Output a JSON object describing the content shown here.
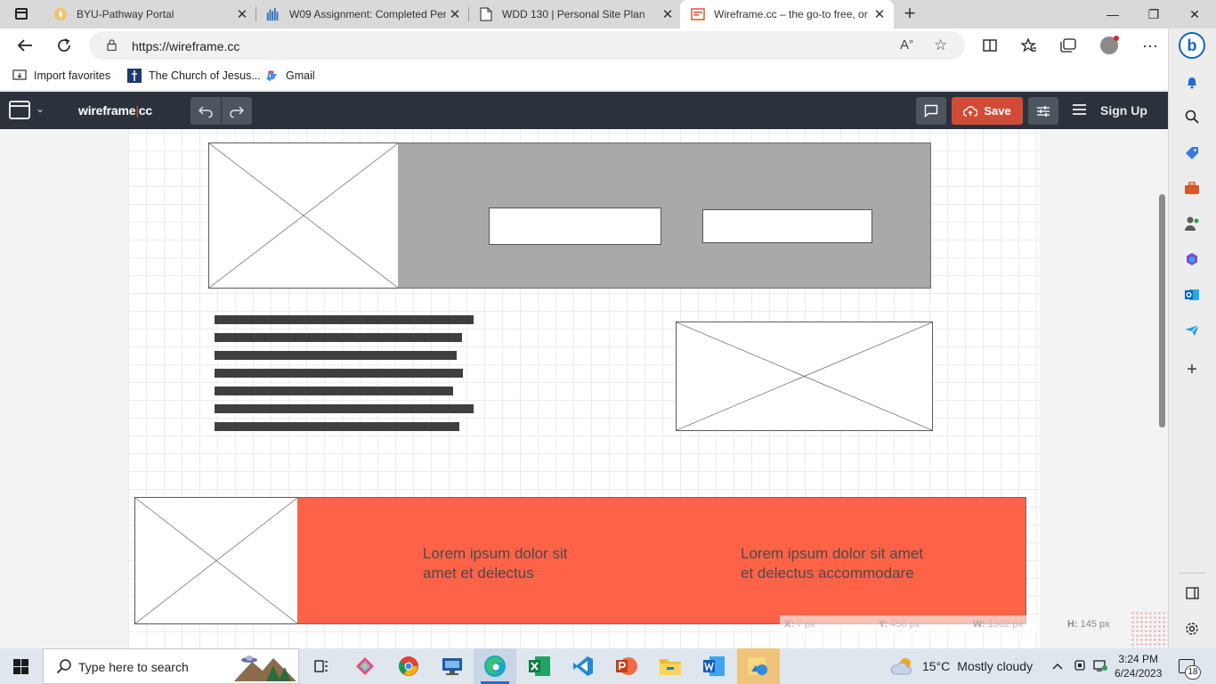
{
  "browser": {
    "tabs": [
      {
        "title": "BYU-Pathway Portal",
        "icon": "pathway-favicon",
        "active": false
      },
      {
        "title": "W09 Assignment: Completed Per",
        "icon": "canvas-favicon",
        "active": false
      },
      {
        "title": "WDD 130 | Personal Site Plan",
        "icon": "document-favicon",
        "active": false
      },
      {
        "title": "Wireframe.cc – the go-to free, or",
        "icon": "wireframe-favicon",
        "active": true
      }
    ],
    "close_glyph": "✕",
    "new_tab_glyph": "+",
    "window_controls": {
      "minimize": "—",
      "maximize": "❐",
      "close": "✕"
    },
    "url": "https://wireframe.cc",
    "favorites": [
      {
        "label": "Import favorites",
        "icon": "import-icon"
      },
      {
        "label": "The Church of Jesus...",
        "icon": "church-icon"
      },
      {
        "label": "Gmail",
        "icon": "google-icon"
      }
    ]
  },
  "app": {
    "logo_left": "wireframe",
    "logo_sep": "|",
    "logo_right": "cc",
    "undo_glyph": "↶",
    "redo_glyph": "↷",
    "save_label": "Save",
    "signup_label": "Sign Up"
  },
  "canvas": {
    "footer_text_1_line_1": "Lorem ipsum dolor sit",
    "footer_text_1_line_2": "amet et delectus",
    "footer_text_2_line_1": "Lorem ipsum dolor sit amet",
    "footer_text_2_line_2": "et delectus accommodare",
    "header_color": "#a9a9a9",
    "footer_color": "#ff6347"
  },
  "statusbar": {
    "x_label": "X:",
    "x_value": "7 px",
    "y_label": "Y:",
    "y_value": "456 px",
    "w_label": "W:",
    "w_value": "1002 px",
    "h_label": "H:",
    "h_value": "145 px"
  },
  "taskbar": {
    "search_placeholder": "Type here to search",
    "apps": [
      "task-view",
      "snipping-tool",
      "chrome",
      "remote-desktop",
      "edge",
      "excel",
      "vscode",
      "powerpoint",
      "file-explorer",
      "word",
      "photos"
    ],
    "weather_temp": "15°C",
    "weather_desc": "Mostly cloudy",
    "time": "3:24 PM",
    "date": "6/24/2023",
    "notification_count": "18"
  }
}
